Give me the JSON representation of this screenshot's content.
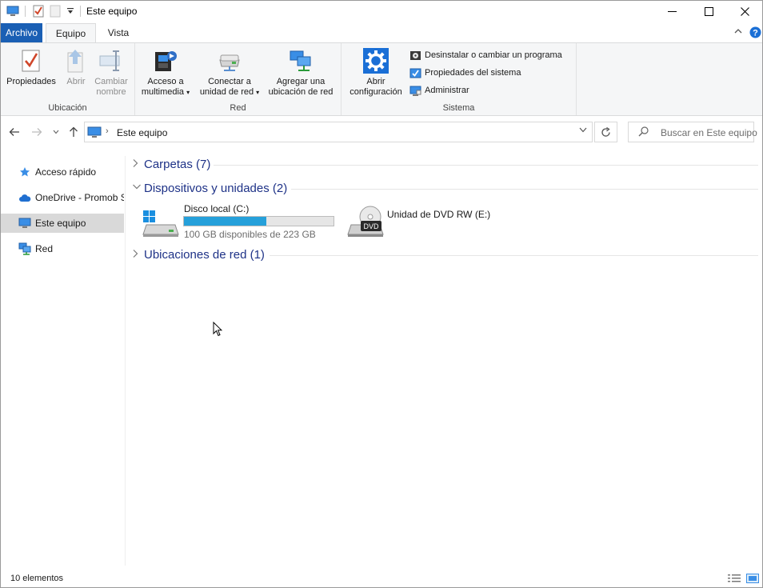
{
  "window": {
    "title": "Este equipo",
    "controls": {
      "minimize": "—",
      "maximize": "☐",
      "close": "✕"
    }
  },
  "ribbon_tabs": [
    {
      "label": "Archivo"
    },
    {
      "label": "Equipo"
    },
    {
      "label": "Vista"
    }
  ],
  "ribbon": {
    "groups": {
      "ubicacion": {
        "label": "Ubicación",
        "buttons": [
          {
            "label_line1": "Propiedades",
            "label_line2": "",
            "enabled": true
          },
          {
            "label_line1": "Abrir",
            "label_line2": "",
            "enabled": false
          },
          {
            "label_line1": "Cambiar",
            "label_line2": "nombre",
            "enabled": false
          }
        ]
      },
      "red": {
        "label": "Red",
        "buttons": [
          {
            "label_line1": "Acceso a",
            "label_line2": "multimedia",
            "dropdown": true
          },
          {
            "label_line1": "Conectar a",
            "label_line2": "unidad de red",
            "dropdown": true
          },
          {
            "label_line1": "Agregar una",
            "label_line2": "ubicación de red",
            "dropdown": false
          }
        ]
      },
      "sistema": {
        "label": "Sistema",
        "big_button": {
          "label_line1": "Abrir",
          "label_line2": "configuración"
        },
        "small_buttons": [
          {
            "label": "Desinstalar o cambiar un programa"
          },
          {
            "label": "Propiedades del sistema"
          },
          {
            "label": "Administrar"
          }
        ]
      }
    }
  },
  "address_bar": {
    "path": "Este equipo",
    "search_placeholder": "Buscar en Este equipo"
  },
  "nav_pane": {
    "items": [
      {
        "label": "Acceso rápido",
        "selected": false
      },
      {
        "label": "OneDrive - Promob S",
        "selected": false
      },
      {
        "label": "Este equipo",
        "selected": true
      },
      {
        "label": "Red",
        "selected": false
      }
    ]
  },
  "content": {
    "groups": [
      {
        "title": "Carpetas (7)",
        "expanded": false
      },
      {
        "title": "Dispositivos y unidades (2)",
        "expanded": true
      },
      {
        "title": "Ubicaciones de red (1)",
        "expanded": false
      }
    ],
    "drives": [
      {
        "name": "Disco local (C:)",
        "free_text": "100 GB disponibles de 223 GB",
        "used_fraction": 0.552
      },
      {
        "name": "Unidad de DVD RW (E:)",
        "badge": "DVD"
      }
    ]
  },
  "status_bar": {
    "text": "10 elementos"
  },
  "colors": {
    "accent": "#1a5fb4",
    "group_title": "#1e3287",
    "drive_fill": "#26a0da",
    "selected_bg": "#d9d9d9"
  }
}
